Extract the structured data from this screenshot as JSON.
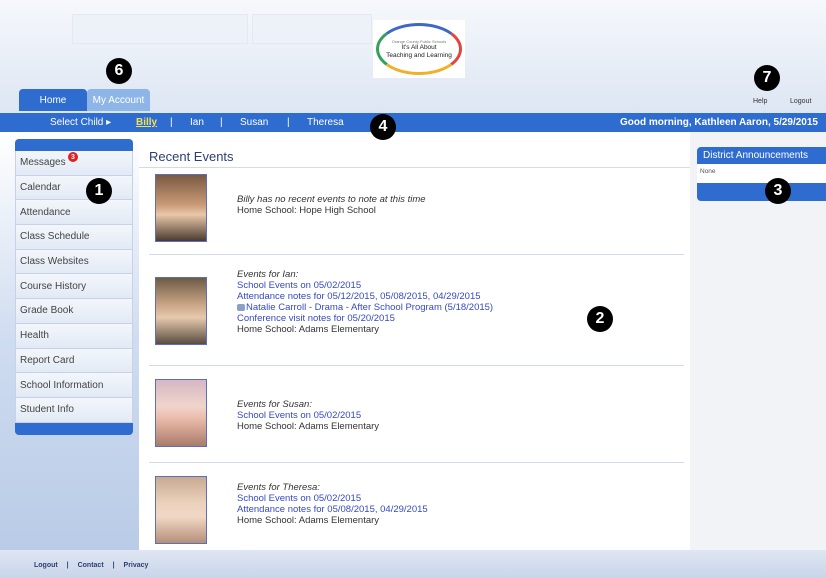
{
  "header": {
    "logo": {
      "top_text": "Orange County Public Schools",
      "line1": "It's All About",
      "line2": "Teaching and Learning"
    },
    "tabs": [
      {
        "label": "Home"
      },
      {
        "label": "My Account"
      }
    ],
    "links": {
      "help": "Help",
      "logout": "Logout"
    }
  },
  "childbar": {
    "select_label": "Select Child ▸",
    "children": [
      "Billy",
      "Ian",
      "Susan",
      "Theresa"
    ],
    "separator": "|",
    "greeting": "Good morning, Kathleen Aaron, 5/29/2015"
  },
  "sidebar": {
    "items": [
      {
        "label": "Messages",
        "badge": "3"
      },
      {
        "label": "Calendar"
      },
      {
        "label": "Attendance"
      },
      {
        "label": "Class Schedule"
      },
      {
        "label": "Class Websites"
      },
      {
        "label": "Course History"
      },
      {
        "label": "Grade Book"
      },
      {
        "label": "Health"
      },
      {
        "label": "Report Card"
      },
      {
        "label": "School Information"
      },
      {
        "label": "Student Info"
      }
    ]
  },
  "main": {
    "title": "Recent Events",
    "events": [
      {
        "heading": "Billy has no recent events to note at this time",
        "links": [],
        "home": "Home School: Hope High School"
      },
      {
        "heading": "Events for Ian:",
        "links": [
          "School Events on 05/02/2015",
          "Attendance notes for 05/12/2015, 05/08/2015, 04/29/2015",
          "Natalie Carroll - Drama - After School Program (5/18/2015)",
          "Conference visit notes for 05/20/2015"
        ],
        "home": "Home School: Adams Elementary"
      },
      {
        "heading": "Events for Susan:",
        "links": [
          "School Events on 05/02/2015"
        ],
        "home": "Home School: Adams Elementary"
      },
      {
        "heading": "Events for Theresa:",
        "links": [
          "School Events on 05/02/2015",
          "Attendance notes for 05/08/2015, 04/29/2015"
        ],
        "home": "Home School: Adams Elementary"
      }
    ]
  },
  "announcements": {
    "title": "District Announcements",
    "body": "None"
  },
  "footer": {
    "links": [
      "Logout",
      "|",
      "Contact",
      "|",
      "Privacy"
    ]
  },
  "callouts": [
    "1",
    "2",
    "3",
    "4",
    "6",
    "7"
  ],
  "colors": {
    "primary_blue": "#2f6cd0",
    "selected_child": "#f4e24a",
    "link": "#3449c4",
    "badge": "#e02020"
  }
}
